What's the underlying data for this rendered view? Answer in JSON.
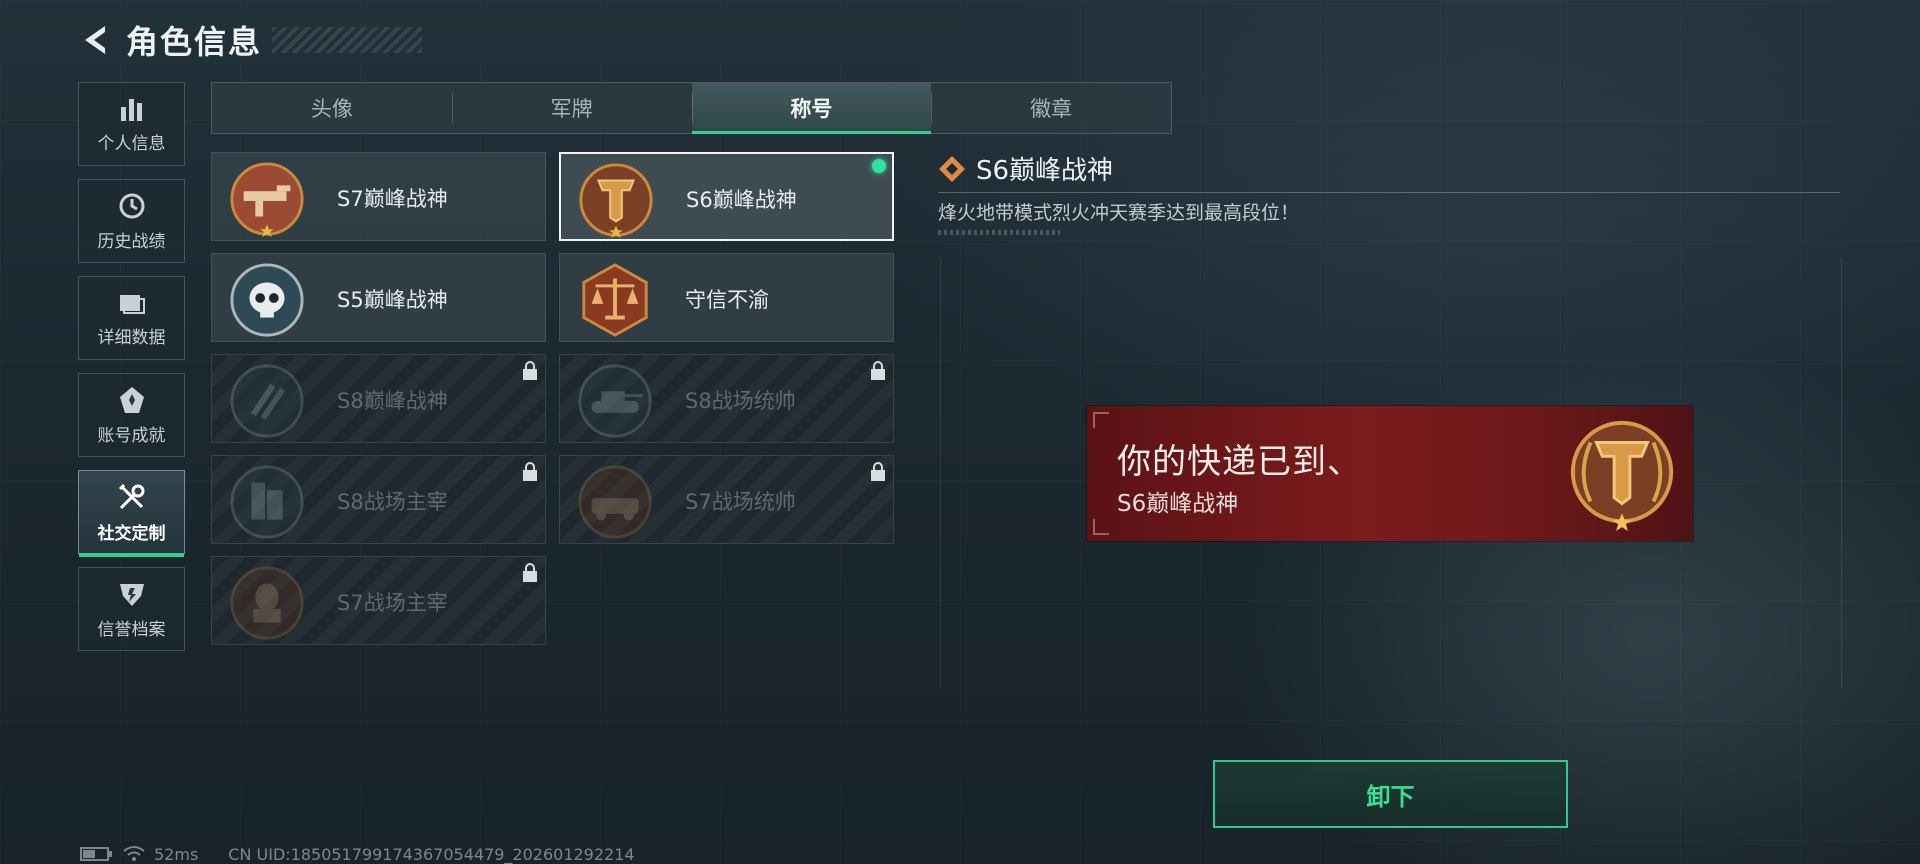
{
  "header": {
    "title": "角色信息"
  },
  "sidenav": [
    {
      "label": "个人信息",
      "icon": "bar-chart-icon",
      "active": false
    },
    {
      "label": "历史战绩",
      "icon": "history-clock-icon",
      "active": false
    },
    {
      "label": "详细数据",
      "icon": "folder-icon",
      "active": false
    },
    {
      "label": "账号成就",
      "icon": "achievement-star-icon",
      "active": false
    },
    {
      "label": "社交定制",
      "icon": "wrench-tools-icon",
      "active": true
    },
    {
      "label": "信誉档案",
      "icon": "shield-icon",
      "active": false
    }
  ],
  "tabs": [
    {
      "label": "头像",
      "active": false
    },
    {
      "label": "军牌",
      "active": false
    },
    {
      "label": "称号",
      "active": true
    },
    {
      "label": "徽章",
      "active": false
    }
  ],
  "titles": [
    {
      "name": "S7巅峰战神",
      "locked": false,
      "selected": false,
      "equipped": false,
      "medal": "gun-medal-icon",
      "color": "#9b4a33"
    },
    {
      "name": "S6巅峰战神",
      "locked": false,
      "selected": true,
      "equipped": true,
      "medal": "t-emblem-medal-icon",
      "color": "#7a3f24"
    },
    {
      "name": "S5巅峰战神",
      "locked": false,
      "selected": false,
      "equipped": false,
      "medal": "skull-medal-icon",
      "color": "#2d4a55"
    },
    {
      "name": "守信不渝",
      "locked": false,
      "selected": false,
      "equipped": false,
      "medal": "scales-medal-icon",
      "color": "#8a3a22"
    },
    {
      "name": "S8巅峰战神",
      "locked": true,
      "selected": false,
      "equipped": false,
      "medal": "slash-medal-icon",
      "color": "#2a3a44"
    },
    {
      "name": "S8战场统帅",
      "locked": true,
      "selected": false,
      "equipped": false,
      "medal": "tank-medal-icon",
      "color": "#2a3a44"
    },
    {
      "name": "S8战场主宰",
      "locked": true,
      "selected": false,
      "equipped": false,
      "medal": "building-medal-icon",
      "color": "#2a3a44"
    },
    {
      "name": "S7战场统帅",
      "locked": true,
      "selected": false,
      "equipped": false,
      "medal": "vehicle-medal-icon",
      "color": "#5a3020"
    },
    {
      "name": "S7战场主宰",
      "locked": true,
      "selected": false,
      "equipped": false,
      "medal": "soldier-medal-icon",
      "color": "#5a3020"
    }
  ],
  "detail": {
    "title": "S6巅峰战神",
    "description": "烽火地带模式烈火冲天赛季达到最高段位！"
  },
  "preview_banner": {
    "line1": "你的快递已到、",
    "line2": "S6巅峰战神"
  },
  "action_button": {
    "label": "卸下"
  },
  "status_bar": {
    "ping": "52ms",
    "uid": "CN UID:18505179917436705447​9_202601292214"
  },
  "colors": {
    "accent_green": "#35d08e",
    "banner_red": "#7c1b1c",
    "medal_gold": "#c98a3c"
  }
}
